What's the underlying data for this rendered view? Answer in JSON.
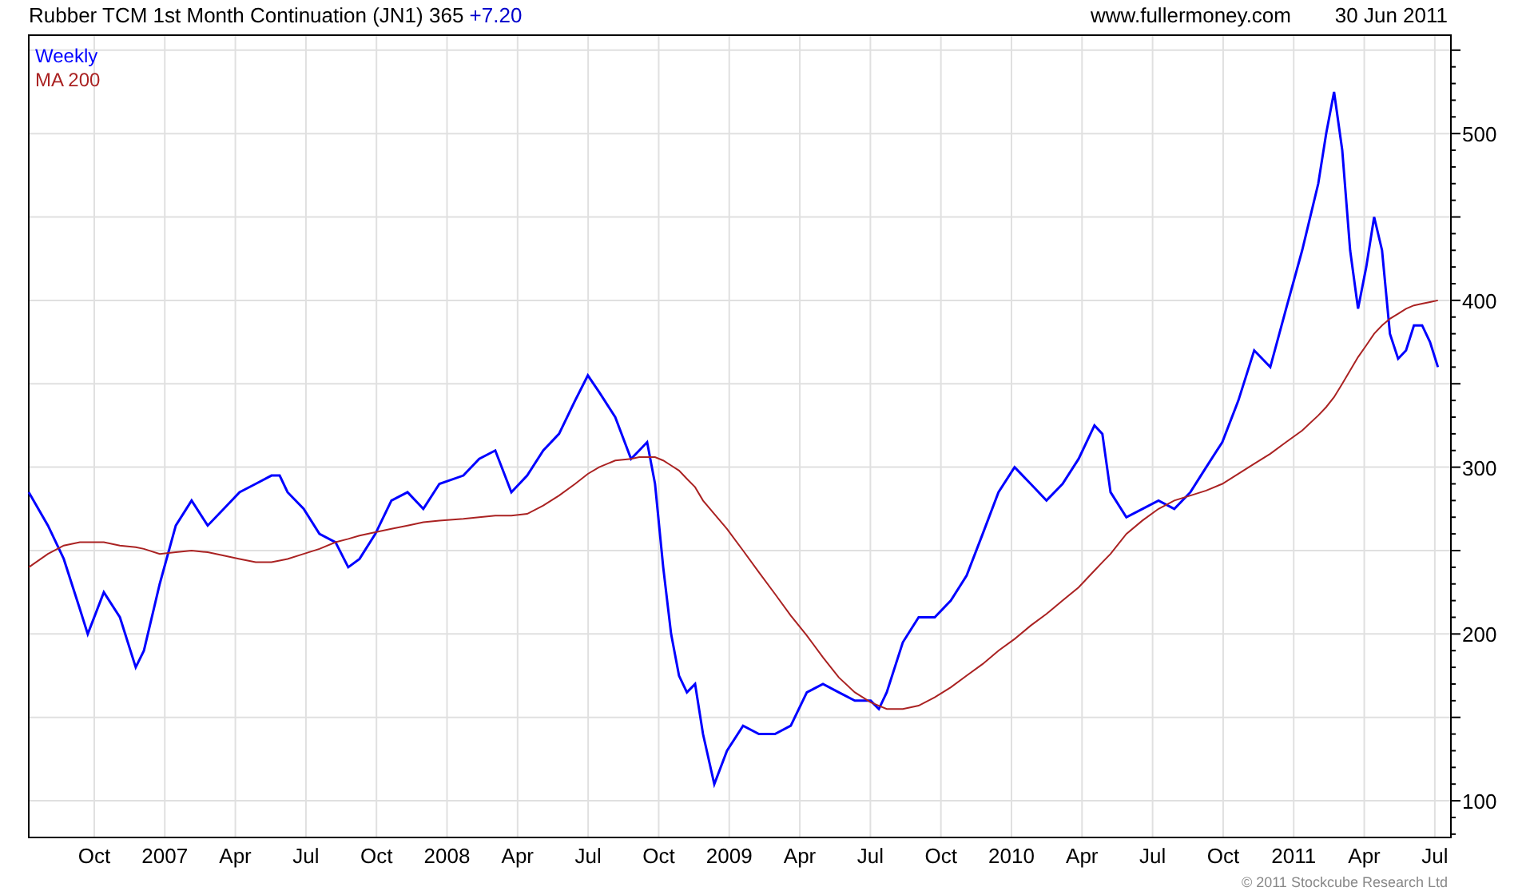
{
  "header": {
    "title": "Rubber TCM 1st Month Continuation (JN1) 365",
    "change": "+7.20",
    "site": "www.fullermoney.com",
    "date": "30 Jun 2011"
  },
  "chart": {
    "chart_data": {
      "type": "line",
      "xlim": [
        2006.518,
        2011.557
      ],
      "ylim": [
        78,
        559
      ],
      "x": [
        2006.518,
        2006.586,
        2006.642,
        2006.699,
        2006.727,
        2006.784,
        2006.841,
        2006.897,
        2006.926,
        2006.982,
        2007.039,
        2007.095,
        2007.152,
        2007.209,
        2007.265,
        2007.322,
        2007.378,
        2007.407,
        2007.435,
        2007.492,
        2007.548,
        2007.605,
        2007.65,
        2007.69,
        2007.746,
        2007.803,
        2007.86,
        2007.916,
        2007.973,
        2008.058,
        2008.114,
        2008.171,
        2008.228,
        2008.284,
        2008.341,
        2008.397,
        2008.454,
        2008.499,
        2008.539,
        2008.596,
        2008.652,
        2008.681,
        2008.709,
        2008.737,
        2008.766,
        2008.794,
        2008.822,
        2008.85,
        2008.879,
        2008.907,
        2008.947,
        2008.992,
        2009.049,
        2009.105,
        2009.162,
        2009.218,
        2009.275,
        2009.332,
        2009.388,
        2009.445,
        2009.501,
        2009.53,
        2009.558,
        2009.615,
        2009.671,
        2009.728,
        2009.785,
        2009.841,
        2009.898,
        2009.954,
        2010.011,
        2010.068,
        2010.124,
        2010.181,
        2010.238,
        2010.294,
        2010.322,
        2010.351,
        2010.407,
        2010.464,
        2010.521,
        2010.577,
        2010.634,
        2010.69,
        2010.747,
        2010.804,
        2010.86,
        2010.917,
        2010.973,
        2011.03,
        2011.087,
        2011.115,
        2011.143,
        2011.172,
        2011.2,
        2011.228,
        2011.257,
        2011.285,
        2011.313,
        2011.341,
        2011.37,
        2011.398,
        2011.426,
        2011.455,
        2011.483,
        2011.511
      ],
      "series": [
        {
          "name": "Weekly",
          "color": "#0000ff",
          "values": [
            285,
            265,
            245,
            215,
            200,
            225,
            210,
            180,
            190,
            230,
            265,
            280,
            265,
            275,
            285,
            290,
            295,
            295,
            285,
            275,
            260,
            255,
            240,
            245,
            260,
            280,
            285,
            275,
            290,
            295,
            305,
            310,
            285,
            295,
            310,
            320,
            340,
            355,
            345,
            330,
            305,
            310,
            315,
            290,
            240,
            200,
            175,
            165,
            170,
            140,
            110,
            130,
            145,
            140,
            140,
            145,
            165,
            170,
            165,
            160,
            160,
            155,
            165,
            195,
            210,
            210,
            220,
            235,
            260,
            285,
            300,
            290,
            280,
            290,
            305,
            325,
            320,
            285,
            270,
            275,
            280,
            275,
            285,
            300,
            315,
            340,
            370,
            360,
            395,
            430,
            470,
            500,
            525,
            490,
            430,
            395,
            420,
            450,
            430,
            380,
            365,
            370,
            385,
            385,
            375,
            360
          ]
        },
        {
          "name": "MA 200",
          "color": "#aa2222",
          "values": [
            240,
            248,
            253,
            255,
            255,
            255,
            253,
            252,
            251,
            248,
            249,
            250,
            249,
            247,
            245,
            243,
            243,
            244,
            245,
            248,
            251,
            255,
            257,
            259,
            261,
            263,
            265,
            267,
            268,
            269,
            270,
            271,
            271,
            272,
            277,
            283,
            290,
            296,
            300,
            304,
            305,
            306,
            306,
            306,
            304,
            301,
            298,
            293,
            288,
            280,
            272,
            263,
            250,
            237,
            224,
            211,
            199,
            186,
            174,
            165,
            159,
            157,
            155,
            155,
            157,
            162,
            168,
            175,
            182,
            190,
            197,
            205,
            212,
            220,
            228,
            238,
            243,
            248,
            260,
            268,
            275,
            280,
            283,
            286,
            290,
            296,
            302,
            308,
            315,
            322,
            331,
            336,
            342,
            350,
            358,
            366,
            373,
            380,
            385,
            389,
            392,
            395,
            397,
            398,
            399,
            400
          ]
        }
      ],
      "yticks": [
        100,
        200,
        300,
        400,
        500
      ],
      "grid": true,
      "xticks": [
        {
          "value": 2006.75,
          "label": "Oct"
        },
        2007,
        {
          "value": 2007.25,
          "label": "Apr"
        },
        {
          "value": 2007.5,
          "label": "Jul"
        },
        {
          "value": 2007.75,
          "label": "Oct"
        },
        2008,
        {
          "value": 2008.25,
          "label": "Apr"
        },
        {
          "value": 2008.5,
          "label": "Jul"
        },
        {
          "value": 2008.75,
          "label": "Oct"
        },
        2009,
        {
          "value": 2009.25,
          "label": "Apr"
        },
        {
          "value": 2009.5,
          "label": "Jul"
        },
        {
          "value": 2009.75,
          "label": "Oct"
        },
        2010,
        {
          "value": 2010.25,
          "label": "Apr"
        },
        {
          "value": 2010.5,
          "label": "Jul"
        },
        {
          "value": 2010.75,
          "label": "Oct"
        },
        2011,
        {
          "value": 2011.25,
          "label": "Apr"
        },
        {
          "value": 2011.5,
          "label": "Jul"
        }
      ]
    }
  },
  "footer": {
    "copyright": "© 2011 Stockcube Research Ltd"
  }
}
